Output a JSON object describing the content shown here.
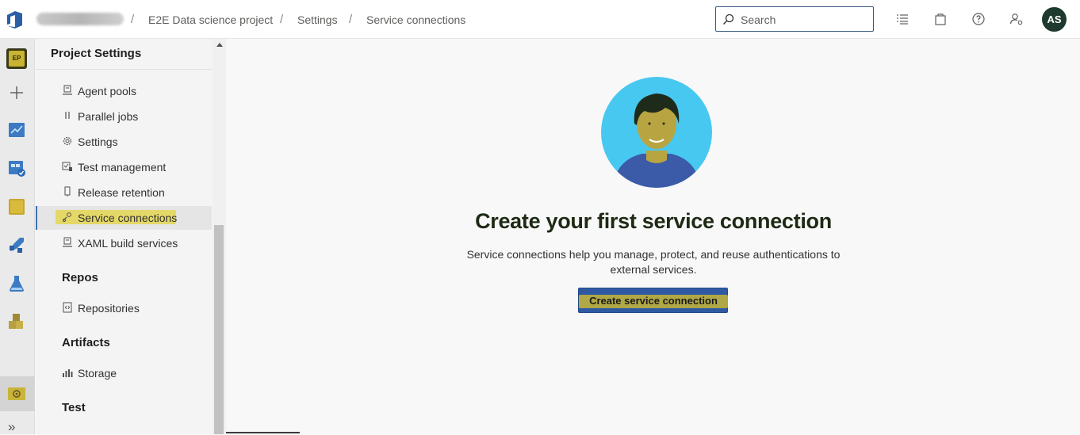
{
  "breadcrumb": {
    "project": "E2E Data science project",
    "settings": "Settings",
    "current": "Service connections",
    "separator": "/"
  },
  "search": {
    "placeholder": "Search"
  },
  "user": {
    "initials": "AS"
  },
  "left_nav": {
    "project_badge": "EP",
    "expand_glyph": "»"
  },
  "settings_panel": {
    "title": "Project Settings",
    "pipelines_items": [
      {
        "label": "Agent pools",
        "icon": "agent-pools-icon"
      },
      {
        "label": "Parallel jobs",
        "icon": "parallel-jobs-icon"
      },
      {
        "label": "Settings",
        "icon": "gear-icon"
      },
      {
        "label": "Test management",
        "icon": "test-management-icon"
      },
      {
        "label": "Release retention",
        "icon": "release-retention-icon"
      },
      {
        "label": "Service connections",
        "icon": "service-connections-icon",
        "selected": true
      },
      {
        "label": "XAML build services",
        "icon": "xaml-build-icon"
      }
    ],
    "repos": {
      "title": "Repos",
      "items": [
        {
          "label": "Repositories",
          "icon": "repositories-icon"
        }
      ]
    },
    "artifacts": {
      "title": "Artifacts",
      "items": [
        {
          "label": "Storage",
          "icon": "storage-icon"
        }
      ]
    },
    "test": {
      "title": "Test"
    }
  },
  "main": {
    "headline": "Create your first service connection",
    "description": "Service connections help you manage, protect, and reuse authentications to external services.",
    "cta_label": "Create service connection"
  },
  "colors": {
    "accent": "#2f5aa3",
    "highlight": "#e3d33e",
    "avatar_bg": "#1e3a2e",
    "illustration_bg": "#47c8f0"
  }
}
